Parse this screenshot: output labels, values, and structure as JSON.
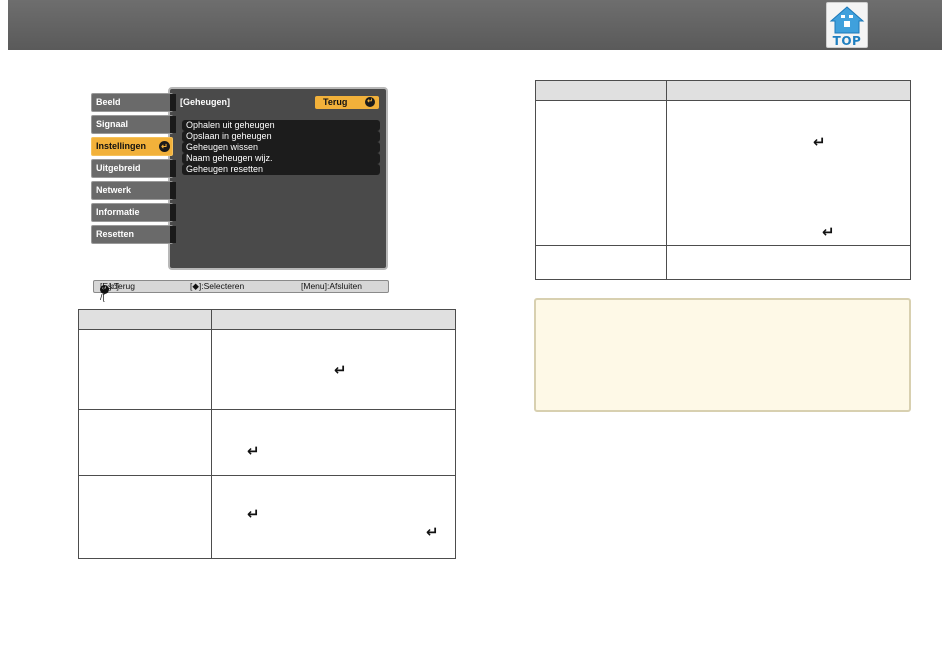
{
  "header": {
    "top_button_label": "TOP",
    "top_icon": "home-icon"
  },
  "osd": {
    "sidebar": [
      {
        "label": "Beeld",
        "active": false
      },
      {
        "label": "Signaal",
        "active": false
      },
      {
        "label": "Instellingen",
        "active": true
      },
      {
        "label": "Uitgebreid",
        "active": false
      },
      {
        "label": "Netwerk",
        "active": false
      },
      {
        "label": "Informatie",
        "active": false
      },
      {
        "label": "Resetten",
        "active": false
      }
    ],
    "panel_title": "[Geheugen]",
    "back_label": "Terug",
    "items": [
      "Ophalen uit geheugen",
      "Opslaan in geheugen",
      "Geheugen wissen",
      "Naam geheugen wijz.",
      "Geheugen resetten"
    ],
    "footer": {
      "esc": "[Esc] /[",
      "esc_after": "]:Terug",
      "select": "[◆]:Selecteren",
      "menu": "[Menu]:Afsluiten"
    },
    "enter_glyph": "↵",
    "accent_color": "#f2b13a"
  },
  "return_glyph": "↵"
}
